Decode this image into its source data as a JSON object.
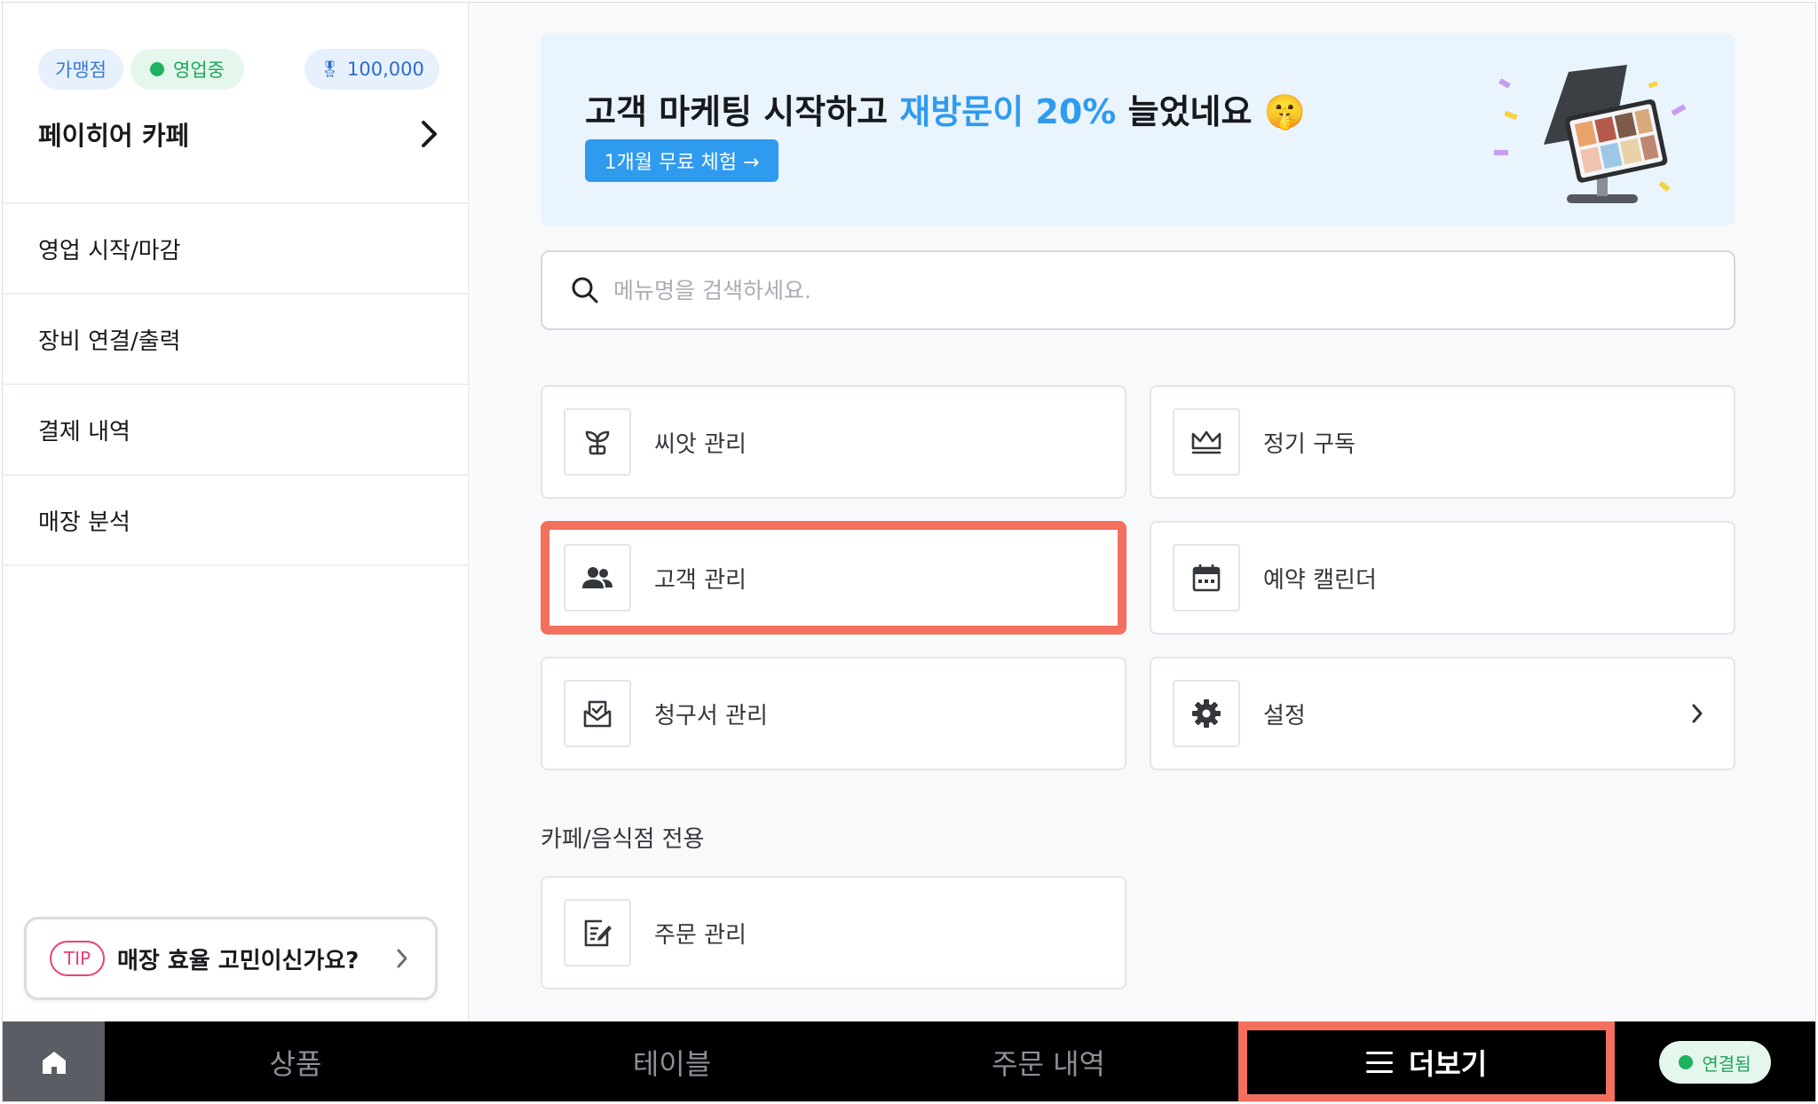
{
  "sidebar": {
    "badges": {
      "franchise": "가맹점",
      "status": "영업중",
      "points": "100,000"
    },
    "store_name": "페이히어 카페",
    "menu": [
      {
        "label": "영업 시작/마감"
      },
      {
        "label": "장비 연결/출력"
      },
      {
        "label": "결제 내역"
      },
      {
        "label": "매장 분석"
      }
    ],
    "tip": {
      "badge": "TIP",
      "text": "매장 효율 고민이신가요?"
    }
  },
  "banner": {
    "title_prefix": "고객 마케팅 시작하고 ",
    "title_accent": "재방문이 20%",
    "title_suffix": " 늘었네요",
    "emoji": "🤫",
    "cta": "1개월 무료 체험 →"
  },
  "search": {
    "placeholder": "메뉴명을 검색하세요."
  },
  "cards": {
    "seed": "씨앗 관리",
    "subscription": "정기 구독",
    "customer": "고객 관리",
    "calendar": "예약 캘린더",
    "invoice": "청구서 관리",
    "settings": "설정"
  },
  "section": {
    "title": "카페/음식점 전용",
    "order": "주문 관리"
  },
  "bottom_nav": {
    "products": "상품",
    "tables": "테이블",
    "orders": "주문 내역",
    "more": "더보기",
    "connection": "연결됨"
  },
  "colors": {
    "accent": "#2f9bef",
    "highlight": "#f36f5e",
    "status_green": "#1fb25f",
    "tip_pink": "#e8417a"
  },
  "icons": [
    "medal-icon",
    "chevron-right-icon",
    "search-icon",
    "sprout-icon",
    "crown-icon",
    "people-icon",
    "calendar-icon",
    "invoice-icon",
    "gear-icon",
    "order-edit-icon",
    "home-icon",
    "hamburger-icon"
  ]
}
